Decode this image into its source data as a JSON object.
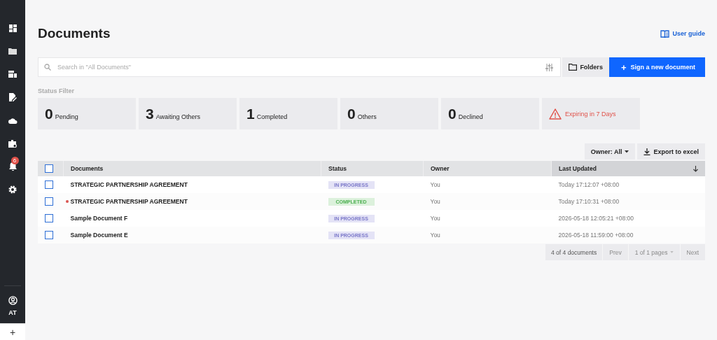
{
  "sidebar": {
    "notification_badge": "6",
    "user": {
      "initials": "AT"
    },
    "add": "+"
  },
  "page": {
    "title": "Documents",
    "user_guide": "User guide"
  },
  "search": {
    "placeholder": "Search in \"All Documents\""
  },
  "buttons": {
    "folders": "Folders",
    "sign_icon": "+",
    "sign": "Sign a new document"
  },
  "status_filter": {
    "label": "Status Filter",
    "cards": [
      {
        "kind": "count",
        "count": "0",
        "label": "Pending"
      },
      {
        "kind": "count",
        "count": "3",
        "label": "Awaiting Others"
      },
      {
        "kind": "count",
        "count": "1",
        "label": "Completed"
      },
      {
        "kind": "count",
        "count": "0",
        "label": "Others"
      },
      {
        "kind": "count",
        "count": "0",
        "label": "Declined"
      },
      {
        "kind": "warning",
        "label": "Expiring in 7 Days"
      }
    ]
  },
  "toolbar": {
    "owner": "Owner: All",
    "export": "Export to excel"
  },
  "table": {
    "select_all_checked": false,
    "columns": [
      {
        "label": "Documents",
        "sorted": false
      },
      {
        "label": "Status",
        "sorted": false
      },
      {
        "label": "Owner",
        "sorted": false
      },
      {
        "label": "Last Updated",
        "sorted": true
      }
    ],
    "rows": [
      {
        "checked": false,
        "unread": false,
        "name": "STRATEGIC PARTNERSHIP AGREEMENT",
        "status": "IN PROGRESS",
        "completed": false,
        "owner": "You",
        "updated": "Today 17:12:07 +08:00"
      },
      {
        "checked": false,
        "unread": true,
        "name": "STRATEGIC PARTNERSHIP AGREEMENT",
        "status": "COMPLETED",
        "completed": true,
        "owner": "You",
        "updated": "Today 17:10:31 +08:00"
      },
      {
        "checked": false,
        "unread": false,
        "name": "Sample Document F",
        "status": "IN PROGRESS",
        "completed": false,
        "owner": "You",
        "updated": "2026-05-18 12:05:21 +08:00"
      },
      {
        "checked": false,
        "unread": false,
        "name": "Sample Document E",
        "status": "IN PROGRESS",
        "completed": false,
        "owner": "You",
        "updated": "2026-05-18 11:59:00 +08:00"
      }
    ]
  },
  "pagination": {
    "count": "4 of 4 documents",
    "prev": "Prev",
    "pages": "1 of 1 pages",
    "next": "Next"
  }
}
